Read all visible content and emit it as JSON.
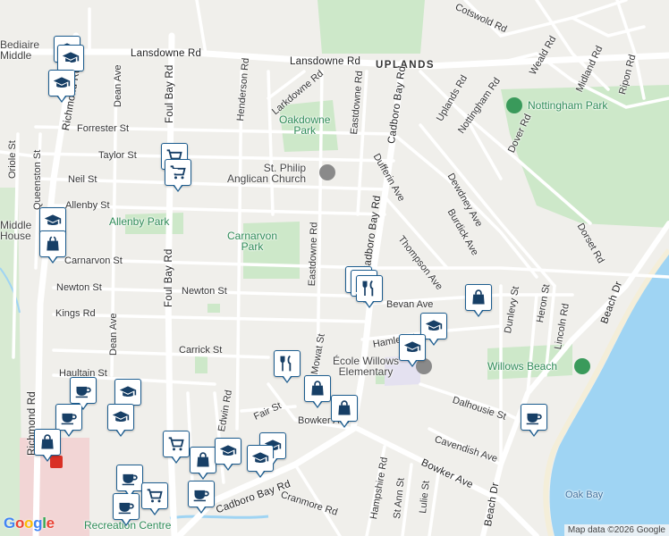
{
  "map": {
    "attribution": "Map data ©2026 Google",
    "logo": "Google",
    "colors": {
      "land": "#f0efeb",
      "road": "#ffffff",
      "road_major": "#ffffff",
      "park": "#cde8c9",
      "water": "#9fd4f3",
      "hospital": "#f2d5d5",
      "school": "#e4e1f0",
      "pin_border": "#1d5d8f"
    }
  },
  "roads": [
    "Lansdowne Rd",
    "Lansdowne Rd",
    "UPLANDS",
    "Foul Bay Rd",
    "Foul Bay Rd",
    "Cadboro Bay Rd",
    "Cadboro Bay Rd",
    "Richmond Rd",
    "Richmond Rd",
    "Henderson Rd",
    "Larkdowne Rd",
    "Eastdowne Rd",
    "Eastdowne Rd",
    "Uplands Rd",
    "Forrester St",
    "Taylor St",
    "Neil St",
    "Allenby St",
    "Carnarvon St",
    "Newton St",
    "Newton St",
    "Kings Rd",
    "Carrick St",
    "Haultain St",
    "Dean Ave",
    "Dean Ave",
    "Oriole St",
    "Queenston St",
    "Dufferin Ave",
    "Thompson Ave",
    "Nottingham Rd",
    "Dover Rd",
    "Dewdney Ave",
    "Burdick Ave",
    "Dorset Rd",
    "Beach Dr",
    "Beach Dr",
    "Heron St",
    "Lincoln Rd",
    "Dalhousie St",
    "Cavendish Ave",
    "Bowker Ave",
    "Bowker Ave",
    "Hampshire Rd",
    "St Ann St",
    "Lulie St",
    "Fair St",
    "Edwin Rd",
    "Cotswold Rd",
    "Weald Rd",
    "Midland Rd",
    "Ripon Rd",
    "Cranmore Rd",
    "Mowat St",
    "Dunlevy St",
    "Hamlet St",
    "Bevan Ave",
    "Cadboro Bay Rd"
  ],
  "places": {
    "oakdowne_park": "Oakdowne\nPark",
    "nottingham_park": "Nottingham Park",
    "st_philip": "St. Philip\nAnglican Church",
    "allenby_park": "Allenby Park",
    "carnarvon_park": "Carnarvon\nPark",
    "ecole_willows": "École Willows\nElementary",
    "willows_beach": "Willows Beach",
    "oak_bay": "Oak Bay",
    "recreation_centre": "Recreation Centre",
    "bediaire_middle": "Bediaire\nMiddle",
    "middle_house": "Middle\nHouse"
  },
  "pins": [
    {
      "icon": "school-icon"
    },
    {
      "icon": "school-icon"
    },
    {
      "icon": "school-icon"
    },
    {
      "icon": "cart-icon"
    },
    {
      "icon": "cart-icon"
    },
    {
      "icon": "school-icon"
    },
    {
      "icon": "bag-icon"
    },
    {
      "icon": "restaurant-icon"
    },
    {
      "icon": "restaurant-icon"
    },
    {
      "icon": "restaurant-icon"
    },
    {
      "icon": "bag-icon"
    },
    {
      "icon": "school-icon"
    },
    {
      "icon": "school-icon"
    },
    {
      "icon": "restaurant-icon"
    },
    {
      "icon": "bag-icon"
    },
    {
      "icon": "bag-icon"
    },
    {
      "icon": "coffee-icon"
    },
    {
      "icon": "coffee-icon"
    },
    {
      "icon": "school-icon"
    },
    {
      "icon": "school-icon"
    },
    {
      "icon": "coffee-icon"
    },
    {
      "icon": "bag-icon"
    },
    {
      "icon": "cart-icon"
    },
    {
      "icon": "bag-icon"
    },
    {
      "icon": "school-icon"
    },
    {
      "icon": "school-icon"
    },
    {
      "icon": "school-icon"
    },
    {
      "icon": "coffee-icon"
    },
    {
      "icon": "cart-icon"
    },
    {
      "icon": "coffee-icon"
    },
    {
      "icon": "coffee-icon"
    }
  ]
}
